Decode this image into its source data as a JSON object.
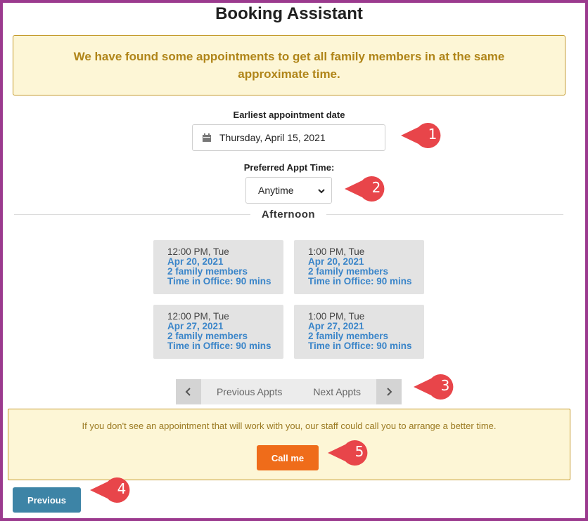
{
  "title": "Booking Assistant",
  "notice_top": "We have found some appointments to get all family members in at the same approximate time.",
  "date": {
    "label": "Earliest appointment date",
    "value": "Thursday, April 15, 2021",
    "icon": "calendar-icon"
  },
  "time_pref": {
    "label": "Preferred Appt Time:",
    "selected": "Anytime"
  },
  "section": "Afternoon",
  "slots": [
    {
      "time": "12:00 PM, Tue",
      "date": "Apr 20, 2021",
      "members": "2 family members",
      "duration": "Time in Office: 90 mins"
    },
    {
      "time": "1:00 PM, Tue",
      "date": "Apr 20, 2021",
      "members": "2 family members",
      "duration": "Time in Office: 90 mins"
    },
    {
      "time": "12:00 PM, Tue",
      "date": "Apr 27, 2021",
      "members": "2 family members",
      "duration": "Time in Office: 90 mins"
    },
    {
      "time": "1:00 PM, Tue",
      "date": "Apr 27, 2021",
      "members": "2 family members",
      "duration": "Time in Office: 90 mins"
    }
  ],
  "pager": {
    "prev": "Previous Appts",
    "next": "Next Appts"
  },
  "notice_bottom": "If you don't see an appointment that will work with you, our staff could call you to arrange a better time.",
  "call_button": "Call me",
  "previous_button": "Previous",
  "callouts": [
    "1",
    "2",
    "3",
    "4",
    "5"
  ],
  "colors": {
    "frame": "#9b3a8e",
    "notice_bg": "#fdf6d6",
    "notice_text": "#b08519",
    "link_blue": "#3a85c9",
    "call_orange": "#ef6c1a",
    "prev_blue": "#3d84a6",
    "callout_red": "#e8454a"
  }
}
